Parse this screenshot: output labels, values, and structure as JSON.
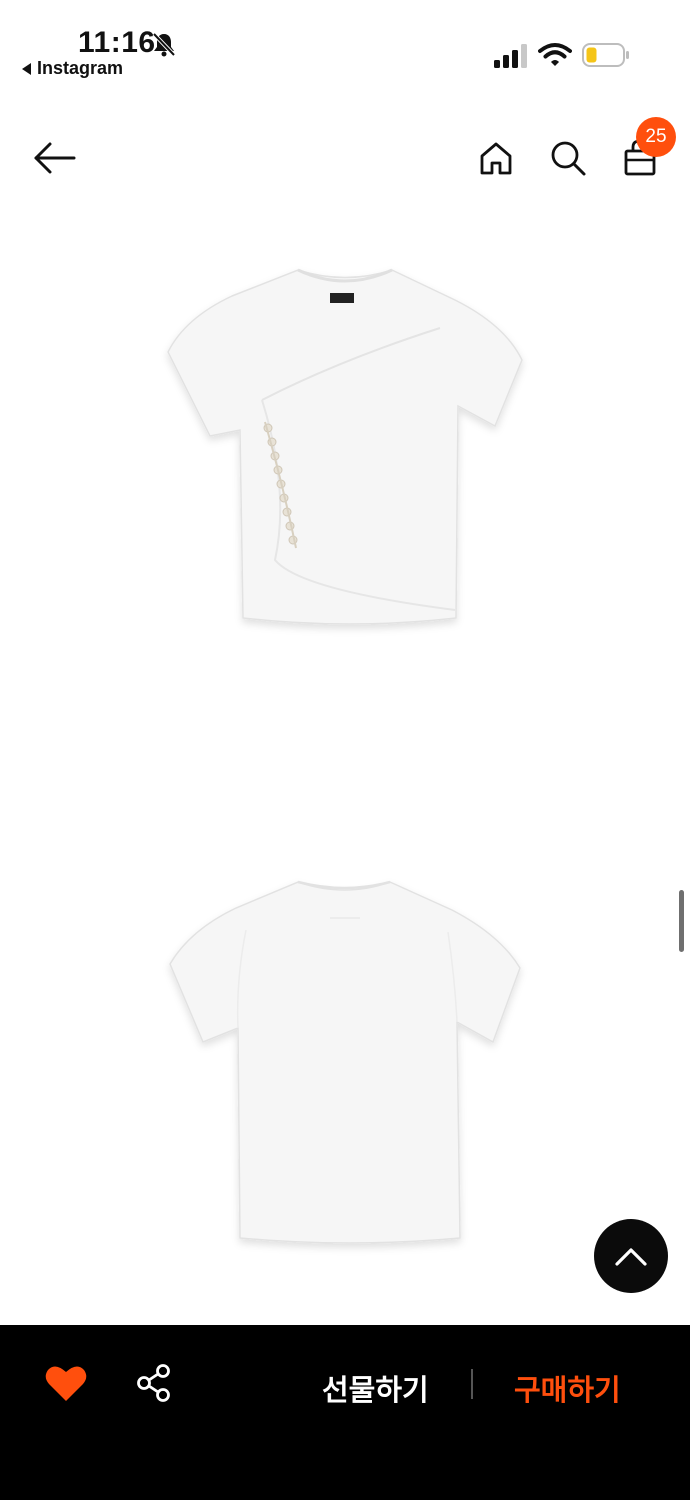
{
  "status_bar": {
    "time": "11:16",
    "back_app_label": "Instagram",
    "icons": [
      "bell-slash-icon",
      "cellular-signal-icon",
      "wifi-icon",
      "battery-low-icon"
    ]
  },
  "top_nav": {
    "icons": [
      "arrow-left-icon",
      "home-icon",
      "search-icon",
      "shopping-bag-icon"
    ],
    "cart_count": "25"
  },
  "product": {
    "images": [
      "t-shirt-front-view",
      "t-shirt-back-view"
    ]
  },
  "bottom_bar": {
    "gift_label": "선물하기",
    "buy_label": "구매하기",
    "icons": [
      "heart-icon",
      "share-icon"
    ]
  },
  "colors": {
    "accent": "#ff4f0d",
    "bottom_bar_bg": "#000000",
    "scroll_top_bg": "#0b0b0b"
  }
}
